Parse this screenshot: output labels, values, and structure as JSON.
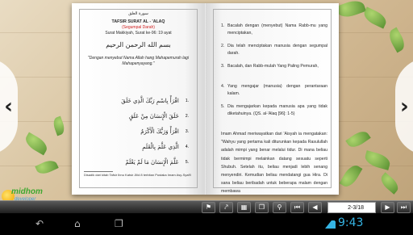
{
  "left_page": {
    "surah_header_ar": "سورة العلق",
    "title": "TAFSIR SURAT AL - 'ALAQ",
    "subtitle": "(Segumpal Darah)",
    "info": "Surat Makkiyah, Surat ke-96: 19 ayat",
    "basmala_ar": "بسم الله الرحمن الرحيم",
    "basmala_translation": "\"Dengan menyebut Nama Allah hang Mahapemurah lagi Mahapenyayang.\"",
    "verses": [
      {
        "num": "1.",
        "ar": "اقْرَأْ بِاسْمِ رَبِّكَ الَّذِي خَلَقَ"
      },
      {
        "num": "2.",
        "ar": "خَلَقَ الْإِنسَانَ مِنْ عَلَقٍ"
      },
      {
        "num": "3.",
        "ar": "اقْرَأْ وَرَبُّكَ الْأَكْرَمُ"
      },
      {
        "num": "4.",
        "ar": "الَّذِي عَلَّمَ بِالْقَلَمِ"
      },
      {
        "num": "5.",
        "ar": "عَلَّمَ الْإِنسَانَ مَا لَمْ يَعْلَمْ"
      }
    ],
    "footnote": "Disadik dari kitab Tafsir Ibnu Katsir Jilid 8 terbitan Pustaka Imam Asy-Syafi'i"
  },
  "right_page": {
    "items": [
      {
        "num": "1.",
        "text": "Bacalah dengan (menyebut) Nama Rabb-mu yang menciptakan,"
      },
      {
        "num": "2.",
        "text": "Dia telah menciptakan manusia dengan segumpal darah."
      },
      {
        "num": "3.",
        "text": "Bacalah, dan Rabb-mulah Yang Paling Pemurah,"
      },
      {
        "num": "4.",
        "text": "Yang mengajar (manusia) dengan perantaraan kalam."
      },
      {
        "num": "5.",
        "text": "Dia mengajarkan kepada manusia apa yang tidak diketahuinya. (QS. al-'Alaq [96]: 1-5)"
      }
    ],
    "paragraph": "Imam Ahmad meriwayatkan dari 'Aisyah ia mengatakan: \"Wahyu yang pertama kali diturunkan kepada Rasulullah adalah mimpi yang benar melalui tidur. Di mana beliau tidak bermimpi melainkan datang sesuatu seperti Shubuh. Setelah itu, beliau menjadi lebih senang menyendiri. Kemudian beliau mendatangi gua Hira. Di sana beliau beribadah untuk beberapa malam dengan membawa"
  },
  "nav": {
    "prev_glyph": "‹",
    "next_glyph": "›"
  },
  "toolbar": {
    "page_indicator": "2-3/18",
    "buttons": [
      "bookmark-icon",
      "share-icon",
      "grid-icon",
      "gallery-icon",
      "zoom-icon",
      "first-page-icon",
      "prev-page-icon",
      "next-page-icon",
      "last-page-icon"
    ]
  },
  "logo": {
    "name": "midhom",
    "sub": "developer"
  },
  "system": {
    "clock": "9:43"
  },
  "colors": {
    "accent_red": "#d02020",
    "clock_blue": "#35b5e5",
    "logo_green": "#3fa830"
  }
}
